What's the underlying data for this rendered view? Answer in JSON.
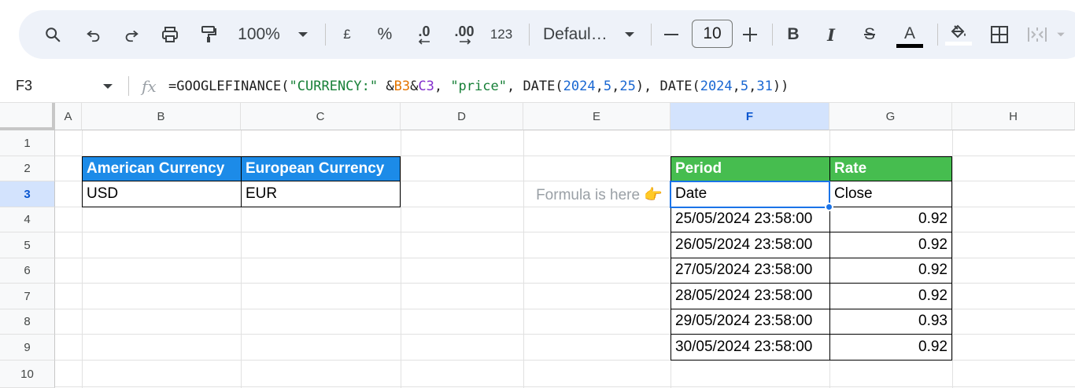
{
  "toolbar": {
    "zoom": "100%",
    "currency_symbol": "£",
    "percent_symbol": "%",
    "decrease_decimal": ".0",
    "increase_decimal": ".00",
    "number_format": "123",
    "font": "Defaul…",
    "font_size": "10",
    "bold": "B",
    "italic": "I",
    "strike": "S",
    "text_color": "A"
  },
  "formula_bar": {
    "cell_ref": "F3",
    "fx": "fx",
    "formula_parts": {
      "p1": "=GOOGLEFINANCE(",
      "p2": "\"CURRENCY:\"",
      "p3": " &",
      "p4": "B3",
      "p5": "&",
      "p6": "C3",
      "p7": ", ",
      "p8": "\"price\"",
      "p9": ", DATE(",
      "p10": "2024",
      "p11": ",",
      "p12": "5",
      "p13": ",",
      "p14": "25",
      "p15": "), DATE(",
      "p16": "2024",
      "p17": ",",
      "p18": "5",
      "p19": ",",
      "p20": "31",
      "p21": "))"
    }
  },
  "columns": [
    "A",
    "B",
    "C",
    "D",
    "E",
    "F",
    "G",
    "H"
  ],
  "rows": [
    "1",
    "2",
    "3",
    "4",
    "5",
    "6",
    "7",
    "8",
    "9",
    "10"
  ],
  "selected_cell": {
    "column": "F",
    "row": "3"
  },
  "cells": {
    "B2": "American Currency",
    "C2": "European Currency",
    "B3": "USD",
    "C3": "EUR",
    "E3": "Formula is here 👉",
    "F2": "Period",
    "G2": "Rate",
    "F3": "Date",
    "G3": "Close",
    "F4": "25/05/2024 23:58:00",
    "G4": "0.92",
    "F5": "26/05/2024 23:58:00",
    "G5": "0.92",
    "F6": "27/05/2024 23:58:00",
    "G6": "0.92",
    "F7": "28/05/2024 23:58:00",
    "G7": "0.92",
    "F8": "29/05/2024 23:58:00",
    "G8": "0.93",
    "F9": "30/05/2024 23:58:00",
    "G9": "0.92"
  },
  "colors": {
    "blue_header": "#1c8be8",
    "green_header": "#46bd4f",
    "selection": "#1a73e8"
  }
}
